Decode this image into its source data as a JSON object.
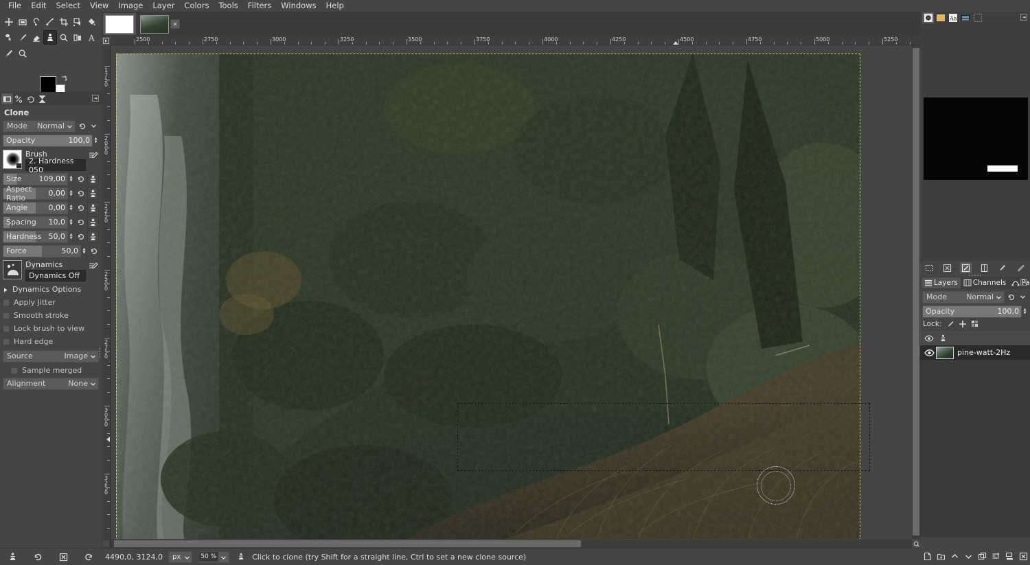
{
  "menu": {
    "items": [
      "File",
      "Edit",
      "Select",
      "View",
      "Image",
      "Layer",
      "Colors",
      "Tools",
      "Filters",
      "Windows",
      "Help"
    ]
  },
  "toolbox": {
    "tools": [
      {
        "name": "move-tool"
      },
      {
        "name": "rectangle-select-tool"
      },
      {
        "name": "free-select-tool"
      },
      {
        "name": "measure-tool"
      },
      {
        "name": "crop-tool"
      },
      {
        "name": "transform-tool"
      },
      {
        "name": "bucket-fill-tool"
      },
      {
        "name": "smudge-tool"
      },
      {
        "name": "paintbrush-tool"
      },
      {
        "name": "eraser-tool"
      },
      {
        "name": "clone-tool"
      },
      {
        "name": "dodge-burn-tool"
      },
      {
        "name": "heal-tool"
      },
      {
        "name": "text-tool"
      },
      {
        "name": "pencil-tool"
      },
      {
        "name": "zoom-tool"
      }
    ],
    "selected": "clone-tool",
    "foreground_color": "#000000",
    "background_color": "#ffffff"
  },
  "tool_options": {
    "title": "Clone",
    "mode": {
      "label": "Mode",
      "value": "Normal"
    },
    "opacity": {
      "label": "Opacity",
      "value": "100,0",
      "fill_percent": 100
    },
    "brush": {
      "label": "Brush",
      "value": "2. Hardness 050"
    },
    "size": {
      "label": "Size",
      "value": "109,00",
      "fill_percent": 22
    },
    "aspect_ratio": {
      "label": "Aspect Ratio",
      "value": "0,00",
      "fill_percent": 50
    },
    "angle": {
      "label": "Angle",
      "value": "0,00",
      "fill_percent": 50
    },
    "spacing": {
      "label": "Spacing",
      "value": "10,0",
      "fill_percent": 10
    },
    "hardness": {
      "label": "Hardness",
      "value": "50,0",
      "fill_percent": 50
    },
    "force": {
      "label": "Force",
      "value": "50,0",
      "fill_percent": 50
    },
    "dynamics": {
      "label": "Dynamics",
      "value": "Dynamics Off"
    },
    "dynamics_options": "Dynamics Options",
    "apply_jitter": "Apply Jitter",
    "smooth_stroke": "Smooth stroke",
    "lock_brush_to_view": "Lock brush to view",
    "hard_edge": "Hard edge",
    "source": {
      "label": "Source",
      "value": "Image"
    },
    "sample_merged": "Sample merged",
    "alignment": {
      "label": "Alignment",
      "value": "None"
    }
  },
  "canvas": {
    "ruler_h_labels": [
      "2500",
      "2750",
      "3000",
      "3250",
      "3500",
      "3750",
      "4000",
      "4250",
      "4500",
      "4750",
      "5000",
      "5250"
    ],
    "ruler_v_labels": [
      "1750",
      "2000",
      "2250",
      "2500",
      "2750",
      "3000",
      "3250"
    ],
    "pointer_marker_x": "4490",
    "pointer_marker_y": "3124"
  },
  "statusbar": {
    "coords": "4490,0, 3124,0",
    "unit": "px",
    "zoom": "50 %",
    "message": "Click to clone (try Shift for a straight line, Ctrl to set a new clone source)"
  },
  "right_dock": {
    "tabs": [
      "brushes-tab",
      "patterns-tab",
      "fonts-tab",
      "document-history-tab",
      "undo-history-tab"
    ],
    "selected_tab": "brushes-tab",
    "brush_buttons": [
      "edit-brush-button",
      "new-brush-button",
      "duplicate-brush-button",
      "delete-brush-button",
      "refresh-brushes-button",
      "open-brush-button"
    ]
  },
  "layers_panel": {
    "tabs": [
      {
        "label": "Layers",
        "icon": "layers-icon"
      },
      {
        "label": "Channels",
        "icon": "channels-icon"
      },
      {
        "label": "Paths",
        "icon": "paths-icon"
      }
    ],
    "selected_tab": "Layers",
    "mode": {
      "label": "Mode",
      "value": "Normal"
    },
    "opacity": {
      "label": "Opacity",
      "value": "100,0",
      "fill_percent": 100
    },
    "lock": {
      "label": "Lock:",
      "icons": [
        "lock-pixels-icon",
        "lock-position-icon",
        "lock-alpha-icon"
      ]
    },
    "layers": [
      {
        "name": "",
        "visible": true,
        "linked": true,
        "is_header": true
      },
      {
        "name": "pine-watt-2Hz",
        "visible": true,
        "selected": true
      }
    ],
    "buttons": [
      "new-layer-button",
      "new-group-button",
      "raise-layer-button",
      "lower-layer-button",
      "duplicate-layer-button",
      "anchor-layer-button",
      "merge-down-button",
      "delete-layer-button"
    ]
  },
  "tabs": {
    "images": [
      {
        "name": "blank-image-tab",
        "selected": true
      },
      {
        "name": "forest-image-tab",
        "selected": false
      }
    ]
  },
  "colors": {
    "panel_bg": "#454545",
    "panel_dark": "#3f3f3f",
    "widget_bg": "#5b5b5b",
    "selection_boundary": "#c9c97a",
    "text": "#dcdcdc"
  }
}
